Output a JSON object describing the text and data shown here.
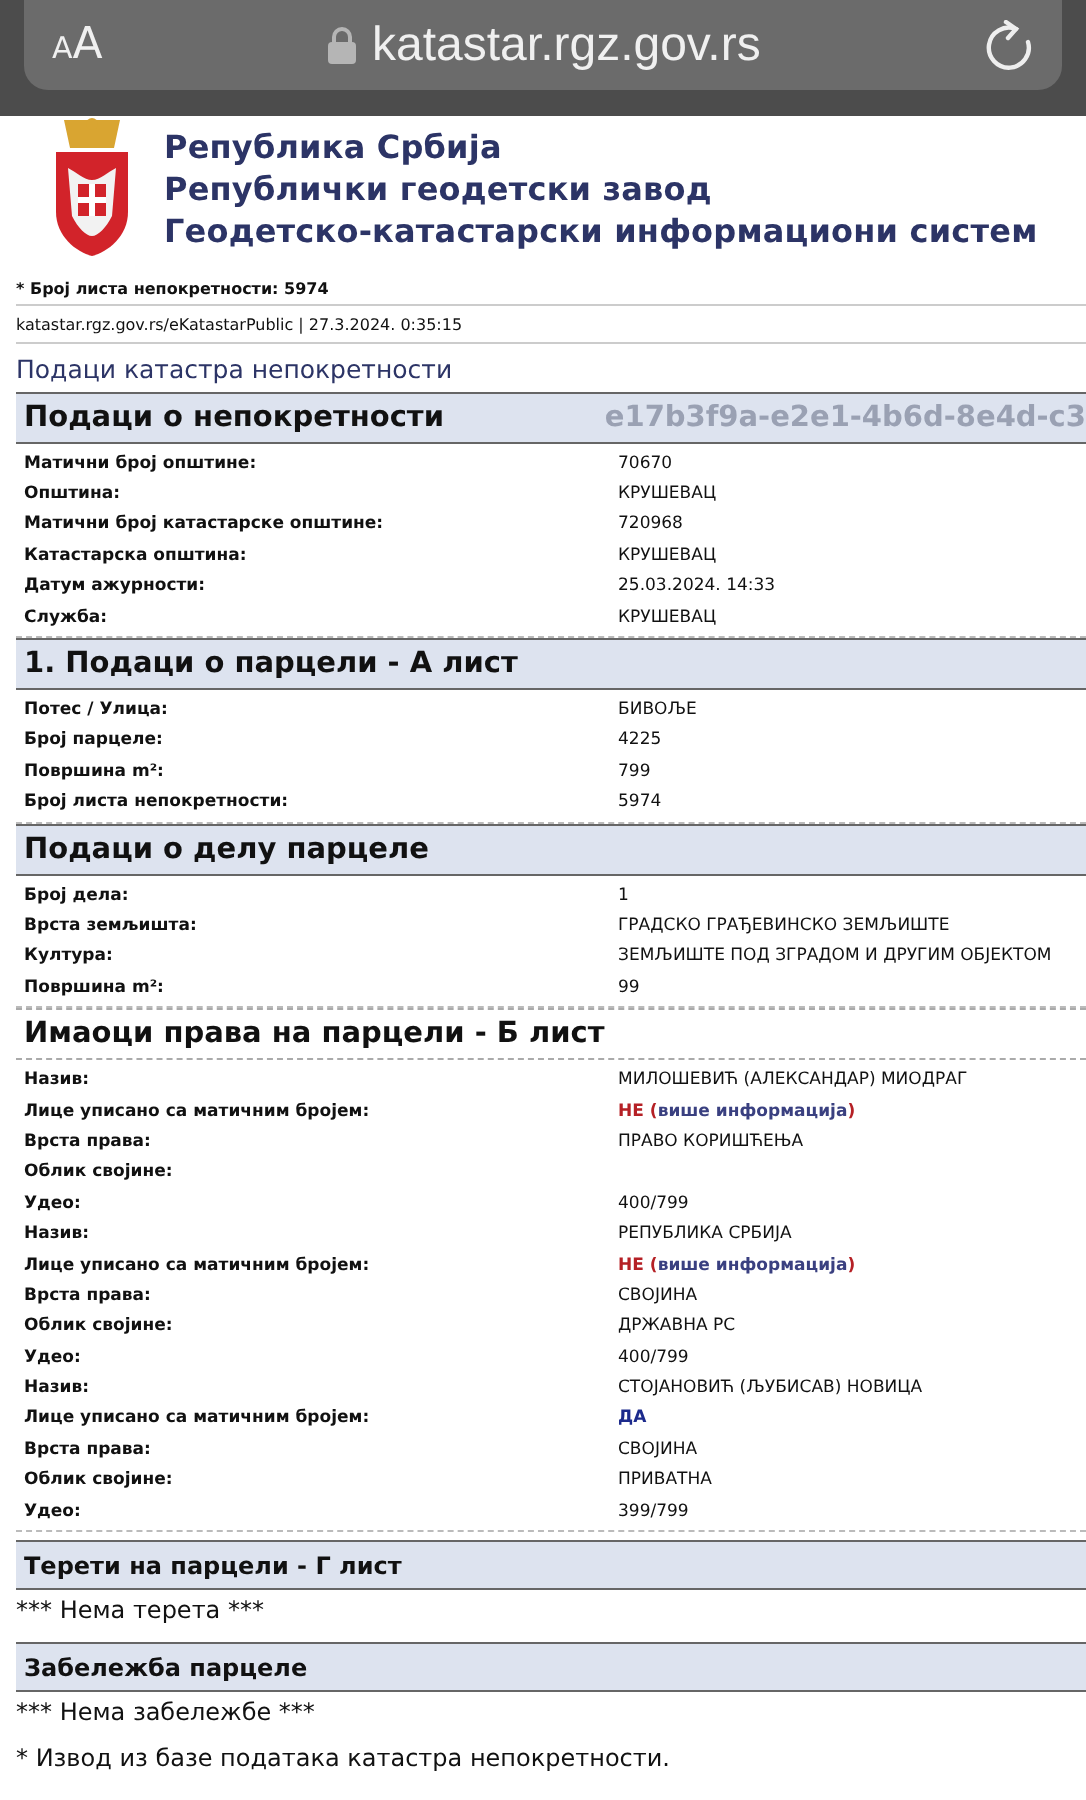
{
  "browser": {
    "text_size_button": "AA",
    "url": "katastar.rgz.gov.rs"
  },
  "header": {
    "lines": [
      "Република Србија",
      "Републички геодетски завод",
      "Геодетско-катастарски информациони систем"
    ]
  },
  "sheet_number": "* Број листа непокретности: 5974",
  "source": "katastar.rgz.gov.rs/eKatastarPublic | 27.3.2024. 0:35:15",
  "page_title": "Подаци катастра непокретности",
  "sections": [
    {
      "title": "Подаци о непокретности",
      "kind": "major",
      "id_text": "e17b3f9a-e2e1-4b6d-8e4d-c3",
      "rows": [
        {
          "kind": "text",
          "label": "Матични број општине:",
          "value": "70670"
        },
        {
          "kind": "text",
          "label": "Општина:",
          "value": "КРУШЕВАЦ"
        },
        {
          "kind": "text",
          "label": "Матични број катастарске општине:",
          "value": "720968"
        },
        {
          "kind": "text",
          "label": "Катастарска општина:",
          "value": "КРУШЕВАЦ"
        },
        {
          "kind": "text",
          "label": "Датум ажурности:",
          "value": "25.03.2024. 14:33"
        },
        {
          "kind": "text",
          "label": "Служба:",
          "value": "КРУШЕВАЦ"
        }
      ]
    },
    {
      "title": "1. Подаци о парцели - А лист",
      "kind": "major",
      "rows": [
        {
          "kind": "text",
          "label": "Потес / Улица:",
          "value": "БИВОЉЕ"
        },
        {
          "kind": "text",
          "label": "Број парцеле:",
          "value": "4225"
        },
        {
          "kind": "text",
          "label": "Површина m²:",
          "value": "799"
        },
        {
          "kind": "text",
          "label": "Број листа непокретности:",
          "value": "5974"
        }
      ]
    },
    {
      "title": "Подаци о делу парцеле",
      "kind": "major",
      "rows": [
        {
          "kind": "text",
          "label": "Број дела:",
          "value": "1"
        },
        {
          "kind": "text",
          "label": "Врста земљишта:",
          "value": "ГРАДСКО ГРАЂЕВИНСКО ЗЕМЉИШТЕ"
        },
        {
          "kind": "text",
          "label": "Култура:",
          "value": "ЗЕМЉИШТЕ ПОД ЗГРАДОМ И ДРУГИМ ОБЈЕКТОМ"
        },
        {
          "kind": "text",
          "label": "Површина m²:",
          "value": "99"
        }
      ]
    },
    {
      "title": "Имаоци права на парцели - Б лист",
      "kind": "owners",
      "rows": [
        {
          "kind": "text",
          "label": "Назив:",
          "value": "МИЛОШЕВИЋ (АЛЕКСАНДАР) МИОДРАГ"
        },
        {
          "kind": "flag",
          "label": "Лице уписано са матичним бројем:",
          "flag": "НЕ",
          "positive": false,
          "open": "(",
          "link": "више информација",
          "close": ")"
        },
        {
          "kind": "text",
          "label": "Врста права:",
          "value": "ПРАВО КОРИШЋЕЊА"
        },
        {
          "kind": "text",
          "label": "Облик својине:"
        },
        {
          "kind": "text",
          "label": "Удео:",
          "value": "400/799"
        },
        {
          "kind": "text",
          "label": "Назив:",
          "value": "РЕПУБЛИКА СРБИЈА"
        },
        {
          "kind": "flag",
          "label": "Лице уписано са матичним бројем:",
          "flag": "НЕ",
          "positive": false,
          "open": "(",
          "link": "више информација",
          "close": ")"
        },
        {
          "kind": "text",
          "label": "Врста права:",
          "value": "СВОЈИНА"
        },
        {
          "kind": "text",
          "label": "Облик својине:",
          "value": "ДРЖАВНА РС"
        },
        {
          "kind": "text",
          "label": "Удео:",
          "value": "400/799"
        },
        {
          "kind": "text",
          "label": "Назив:",
          "value": "СТОЈАНОВИЋ (ЉУБИСАВ) НОВИЦА"
        },
        {
          "kind": "flag",
          "label": "Лице уписано са матичним бројем:",
          "flag": "ДА",
          "positive": true
        },
        {
          "kind": "text",
          "label": "Врста права:",
          "value": "СВОЈИНА"
        },
        {
          "kind": "text",
          "label": "Облик својине:",
          "value": "ПРИВАТНА"
        },
        {
          "kind": "text",
          "label": "Удео:",
          "value": "399/799"
        }
      ]
    },
    {
      "title": "Терети на парцели - Г лист",
      "kind": "minor",
      "note": "*** Нема терета ***"
    },
    {
      "title": "Забележба парцеле",
      "kind": "minor",
      "note": "*** Нема забележбе ***"
    }
  ],
  "footer": "* Извод из базе података катастра непокретности."
}
